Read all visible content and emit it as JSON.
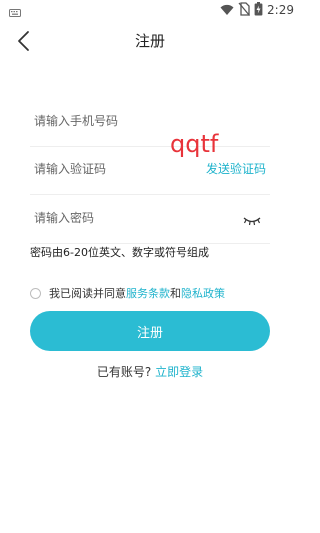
{
  "status_bar": {
    "time": "2:29",
    "icons": [
      "keyboard-icon",
      "wifi-icon",
      "no-sim-icon",
      "battery-icon"
    ]
  },
  "header": {
    "title": "注册",
    "back_icon": "chevron-left-icon"
  },
  "form": {
    "phone_placeholder": "请输入手机号码",
    "code_placeholder": "请输入验证码",
    "send_code_label": "发送验证码",
    "password_placeholder": "请输入密码",
    "password_hint": "密码由6-20位英文、数字或符号组成",
    "overlay_text": "qqtf"
  },
  "agreement": {
    "prefix": "我已阅读并同意",
    "terms": "服务条款",
    "and": "和",
    "privacy": "隐私政策"
  },
  "register_button": "注册",
  "login": {
    "prompt": "已有账号?",
    "link": "立即登录"
  },
  "colors": {
    "accent": "#2bbcd3",
    "link": "#1fb3cc",
    "overlay": "#e8333a"
  }
}
